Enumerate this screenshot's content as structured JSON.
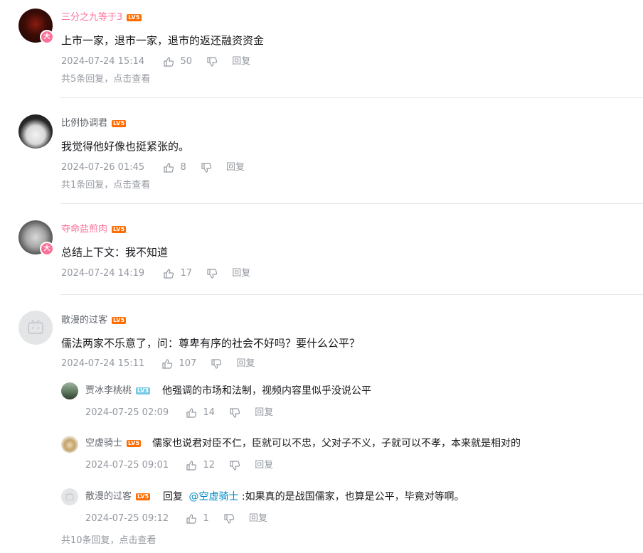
{
  "comments": [
    {
      "user": "三分之九等于3",
      "level": "LV5",
      "text": "上市一家，退市一家，退市的返还融资资金",
      "time": "2024-07-24 15:14",
      "likes": "50",
      "reply_label": "回复",
      "more": "共5条回复，点击查看",
      "avatar_badge": "大"
    },
    {
      "user": "比例协调君",
      "level": "LV5",
      "text": "我觉得他好像也挺紧张的。",
      "time": "2024-07-26 01:45",
      "likes": "8",
      "reply_label": "回复",
      "more": "共1条回复，点击查看"
    },
    {
      "user": "夺命盐煎肉",
      "level": "LV5",
      "text": "总结上下文：我不知道",
      "time": "2024-07-24 14:19",
      "likes": "17",
      "reply_label": "回复",
      "avatar_badge": "大"
    },
    {
      "user": "散漫的过客",
      "level": "LV5",
      "text": "儒法两家不乐意了，问：尊卑有序的社会不好吗？要什么公平？",
      "time": "2024-07-24 15:11",
      "likes": "107",
      "reply_label": "回复",
      "more": "共10条回复，点击查看",
      "replies": [
        {
          "user": "贾冰李桃桃",
          "level": "LV3",
          "text": "他强调的市场和法制，视频内容里似乎没说公平",
          "time": "2024-07-25 02:09",
          "likes": "14",
          "reply_label": "回复"
        },
        {
          "user": "空虚骑士",
          "level": "LV5",
          "text": "儒家也说君对臣不仁，臣就可以不忠，父对子不义，子就可以不孝，本来就是相对的",
          "time": "2024-07-25 09:01",
          "likes": "12",
          "reply_label": "回复"
        },
        {
          "user": "散漫的过客",
          "level": "LV5",
          "prefix": "回复",
          "mention": "@空虚骑士",
          "text": ":如果真的是战国儒家，也算是公平，毕竟对等啊。",
          "time": "2024-07-25 09:12",
          "likes": "1",
          "reply_label": "回复"
        }
      ]
    }
  ],
  "colors": {
    "vip_name": "#fb7299",
    "normal_name": "#61666d",
    "meta": "#9499a0",
    "level_badge": "#ff6c00",
    "level_badge_low": "#73c9e5",
    "mention": "#008ac5",
    "divider": "#e3e5e7"
  }
}
